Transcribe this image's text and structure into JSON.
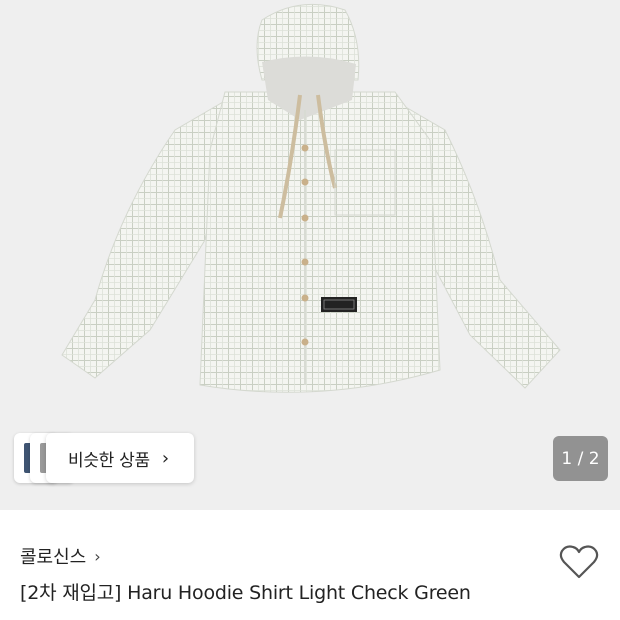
{
  "gallery": {
    "similar_label": "비슷한 상품",
    "similar_chevron": "›",
    "counter": "1 / 2",
    "thumb_colors": [
      "#3f5472",
      "#9a9a9a"
    ],
    "image_icon": "hoodie-shirt-image"
  },
  "product": {
    "brand": "콜로신스",
    "brand_chevron": "›",
    "title": "[2차 재입고] Haru Hoodie Shirt Light Check Green",
    "like_icon": "heart-icon"
  }
}
